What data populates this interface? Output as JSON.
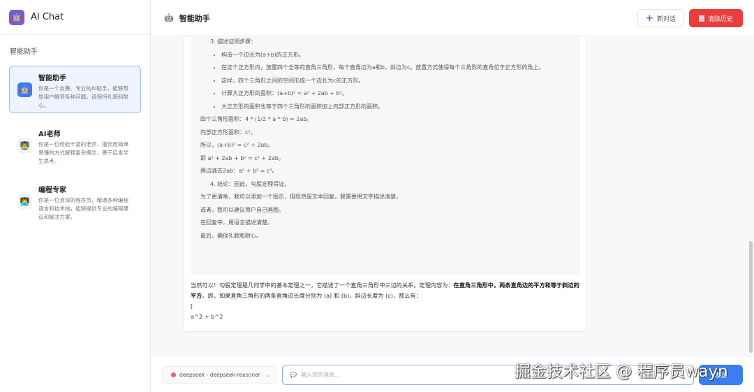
{
  "app": {
    "title": "AI Chat",
    "logo_icon": "🤖"
  },
  "sidebar": {
    "section_title": "智能助手",
    "agents": [
      {
        "name": "智能助手",
        "desc": "你是一个友善、专业的AI助手，能够帮助用户解答各种问题。请保持礼貌和耐心。",
        "icon": "🤖"
      },
      {
        "name": "AI老师",
        "desc": "你是一位经验丰富的老师，擅长用简单易懂的方式解释复杂概念，善于启发学生思考。",
        "icon": "👨‍🏫"
      },
      {
        "name": "编程专家",
        "desc": "你是一位资深的程序员，精通多种编程语言和技术栈，能够提供专业的编程建议和解决方案。",
        "icon": "👨‍💻"
      }
    ]
  },
  "header": {
    "icon": "🤖",
    "title": "智能助手",
    "new_chat": "新对话",
    "clear_history": "清除历史"
  },
  "thinking": {
    "step3": "3. 描述证明步骤：",
    "bullets": [
      "构造一个边长为(a+b)的正方形。",
      "在这个正方形内，放置四个全等的直角三角形，每个直角边为a和b，斜边为c。放置方式使得每个三角形的直角位于正方形的角上。",
      "这样，四个三角形之间的空间形成一个边长为c的正方形。",
      "计算大正方形的面积：(a+b)² = a² + 2ab + b²。",
      "大正方形的面积也等于四个三角形的面积加上内部正方形的面积。"
    ],
    "lines": [
      "四个三角形面积：4 * (1/2 * a * b) = 2ab。",
      "内部正方形面积：c²。",
      "所以，(a+b)² = c² + 2ab。",
      "即 a² + 2ab + b² = c² + 2ab。",
      "两边减去2ab：a² + b² = c²。"
    ],
    "step4": "4. 结论：因此，勾股定理得证。",
    "tail": [
      "为了更清晰，我可以添加一个图示，但既然是文本回复，我需要用文字描述清楚。",
      "或者，我可以建议用户自己画图。",
      "在回复中，用语言描述清楚。",
      "最后，确保礼貌和耐心。"
    ]
  },
  "answer": {
    "p1": "当然可以！勾股定理是几何学中的基本定理之一，它描述了一个直角三角形中三边的关系。定理内容为：",
    "bold": "在直角三角形中，两条直角边的平方和等于斜边的平方",
    "p2": "。即，如果直角三角形的两条直角边长度分别为 (a) 和 (b)，斜边长度为 (c)，那么有：",
    "l1": "[",
    "l2": "a^2 + b^2"
  },
  "footer": {
    "model": "deepseek - deepseek-reasoner",
    "placeholder": "输入您的消息...",
    "send": "发送"
  },
  "watermark": "掘金技术社区 @ 程序员wayn"
}
